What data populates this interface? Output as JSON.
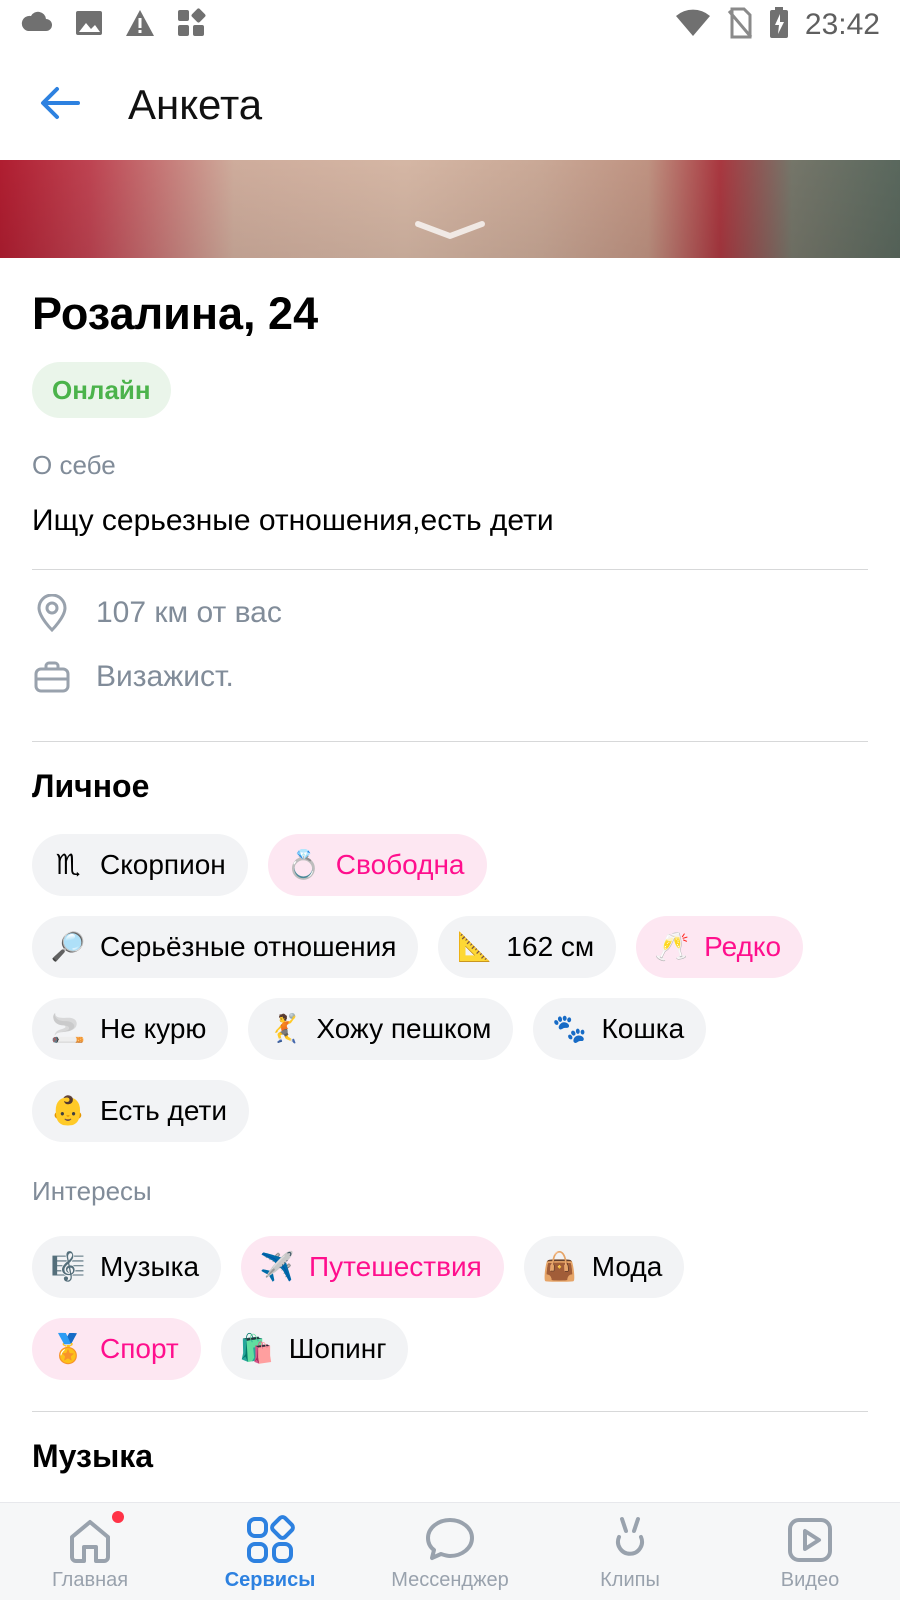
{
  "status_bar": {
    "time": "23:42",
    "left_icons": [
      "cloud-icon",
      "image-icon",
      "warning-icon",
      "apps-icon"
    ],
    "right_icons": [
      "wifi-icon",
      "no-sim-icon",
      "battery-charging-icon"
    ]
  },
  "header": {
    "title": "Анкета",
    "back_icon": "arrow-left-icon"
  },
  "profile": {
    "name": "Розалина, 24",
    "status": "Онлайн",
    "about_label": "О себе",
    "about_text": "Ищу серьезные отношения,есть дети",
    "distance": "107 км от вас",
    "occupation": "Визажист."
  },
  "sections": {
    "personal_title": "Личное",
    "interests_title": "Интересы",
    "music_title": "Музыка"
  },
  "personal_chips": [
    {
      "icon": "♏",
      "label": "Скорпион",
      "highlight": false
    },
    {
      "icon": "💍",
      "label": "Свободна",
      "highlight": true
    },
    {
      "icon": "🔎",
      "label": "Серьёзные отношения",
      "highlight": false
    },
    {
      "icon": "📐",
      "label": "162 см",
      "highlight": false
    },
    {
      "icon": "🥂",
      "label": "Редко",
      "highlight": true
    },
    {
      "icon": "🚬",
      "label": "Не курю",
      "highlight": false
    },
    {
      "icon": "🤾",
      "label": "Хожу пешком",
      "highlight": false
    },
    {
      "icon": "🐾",
      "label": "Кошка",
      "highlight": false
    },
    {
      "icon": "👶",
      "label": "Есть дети",
      "highlight": false
    }
  ],
  "interest_chips": [
    {
      "icon": "🎼",
      "label": "Музыка",
      "highlight": false
    },
    {
      "icon": "✈️",
      "label": "Путешествия",
      "highlight": true
    },
    {
      "icon": "👜",
      "label": "Мода",
      "highlight": false
    },
    {
      "icon": "🏅",
      "label": "Спорт",
      "highlight": true
    },
    {
      "icon": "🛍️",
      "label": "Шопинг",
      "highlight": false
    }
  ],
  "tabbar": {
    "items": [
      {
        "label": "Главная",
        "icon": "home-icon",
        "active": false
      },
      {
        "label": "Сервисы",
        "icon": "services-icon",
        "active": true
      },
      {
        "label": "Мессенджер",
        "icon": "messenger-icon",
        "active": false
      },
      {
        "label": "Клипы",
        "icon": "clips-icon",
        "active": false
      },
      {
        "label": "Видео",
        "icon": "video-icon",
        "active": false
      }
    ]
  },
  "colors": {
    "accent": "#2d81e0",
    "online": "#4bb34b",
    "online_bg": "#eaf5ea",
    "chip_bg": "#f2f3f5",
    "chip_pink_bg": "#fde7f2",
    "chip_pink_text": "#ff0f8d",
    "secondary_text": "#818c99"
  }
}
